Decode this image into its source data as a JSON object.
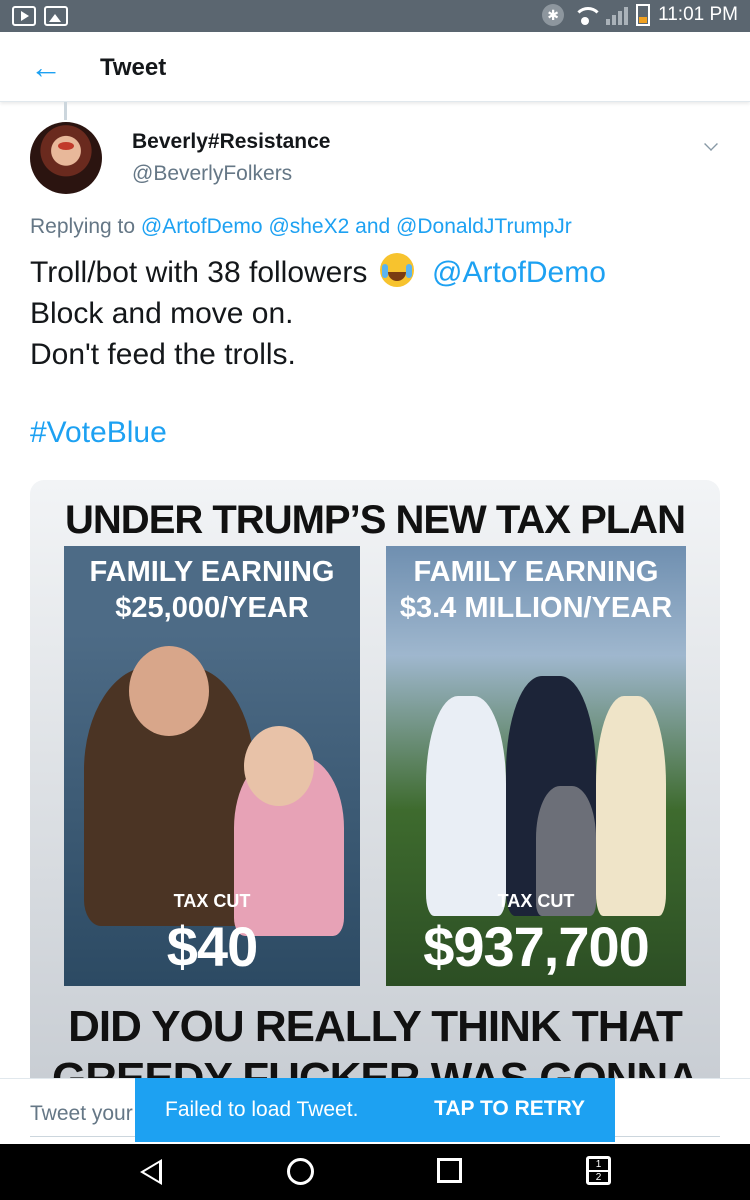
{
  "status_bar": {
    "time": "11:01 PM",
    "left_icons": [
      "youtube-icon",
      "image-icon"
    ],
    "right_icons": [
      "bluetooth-icon",
      "wifi-icon",
      "signal-icon",
      "battery-icon"
    ]
  },
  "header": {
    "title": "Tweet",
    "back_icon": "arrow-left-icon"
  },
  "tweet": {
    "author_name": "Beverly#Resistance",
    "author_handle": "@BeverlyFolkers",
    "replying_prefix": "Replying to",
    "reply_mention_1": "@ArtofDemo",
    "reply_mention_2": "@sheX2",
    "reply_and": "and",
    "reply_mention_3": "@DonaldJTrumpJr",
    "text_line1": "Troll/bot with 38 followers",
    "text_mention": "@ArtofDemo",
    "text_line2": "Block and move on.",
    "text_line3": "Don't feed the trolls.",
    "hashtag": "#VoteBlue",
    "emoji": "face-with-tears-of-joy"
  },
  "media": {
    "title": "UNDER TRUMP’S NEW TAX PLAN",
    "left_label_1": "FAMILY EARNING",
    "left_label_2": "$25,000/YEAR",
    "left_cut_label": "TAX CUT",
    "left_cut_value": "$40",
    "right_label_1": "FAMILY EARNING",
    "right_label_2": "$3.4 MILLION/YEAR",
    "right_cut_label": "TAX CUT",
    "right_cut_value": "$937,700",
    "bottom_line_1": "DID YOU REALLY THINK THAT",
    "bottom_line_2": "GREEDY FUCKER WAS GONNA"
  },
  "reply_bar": {
    "placeholder": "Tweet your reply"
  },
  "snackbar": {
    "message": "Failed to load Tweet.",
    "action": "TAP TO RETRY"
  },
  "navbar": {
    "icons": [
      "back-icon",
      "home-icon",
      "recents-icon",
      "dual-window-icon"
    ],
    "dual_top": "1",
    "dual_bottom": "2"
  }
}
